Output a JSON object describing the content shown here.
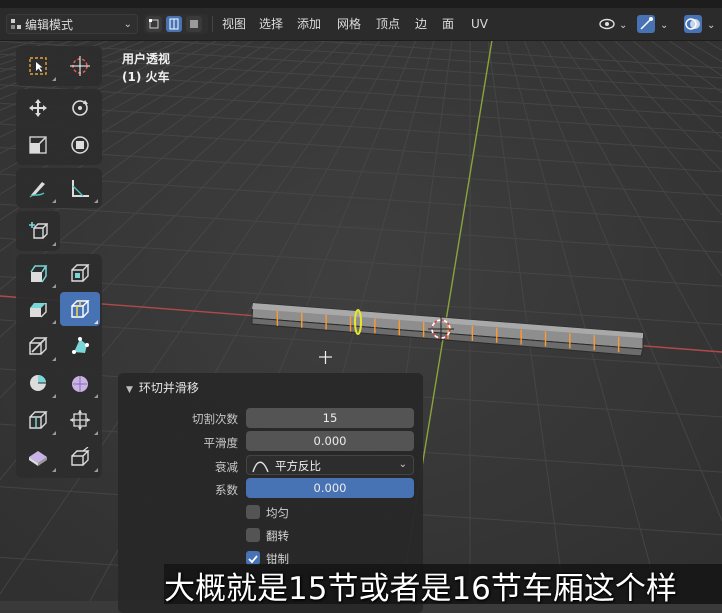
{
  "header": {
    "mode_label": "编辑模式",
    "menu": [
      "视图",
      "选择",
      "添加",
      "网格",
      "顶点",
      "边",
      "面",
      "UV"
    ]
  },
  "viewport": {
    "view_name": "用户透视",
    "object_name": "(1) 火车"
  },
  "operator_panel": {
    "title": "环切并滑移",
    "fields": [
      {
        "label": "切割次数",
        "value": "15"
      },
      {
        "label": "平滑度",
        "value": "0.000"
      },
      {
        "label": "衰减",
        "value": "平方反比"
      },
      {
        "label": "系数",
        "value": "0.000"
      }
    ],
    "checkboxes": [
      {
        "label": "均匀",
        "checked": false
      },
      {
        "label": "翻转",
        "checked": false
      },
      {
        "label": "钳制",
        "checked": true
      }
    ]
  },
  "subtitle": "大概就是15节或者是16节车厢这个样",
  "colors": {
    "accent": "#4772b3",
    "x_axis": "#b04a4a",
    "y_axis": "#8aa33a",
    "edge_highlight": "#ff9a2e",
    "active_loop": "#e6e62e"
  },
  "icons": {
    "tools": [
      "select-box-icon",
      "cursor-icon",
      "move-icon",
      "rotate-icon",
      "scale-icon",
      "transform-icon",
      "annotate-icon",
      "measure-icon",
      "add-cube-icon",
      "extrude-icon",
      "inset-icon",
      "bevel-icon",
      "loop-cut-icon",
      "knife-icon",
      "poly-build-icon",
      "spin-icon",
      "smooth-icon",
      "edge-slide-icon",
      "shrink-fatten-icon",
      "shear-icon",
      "rip-icon"
    ]
  }
}
